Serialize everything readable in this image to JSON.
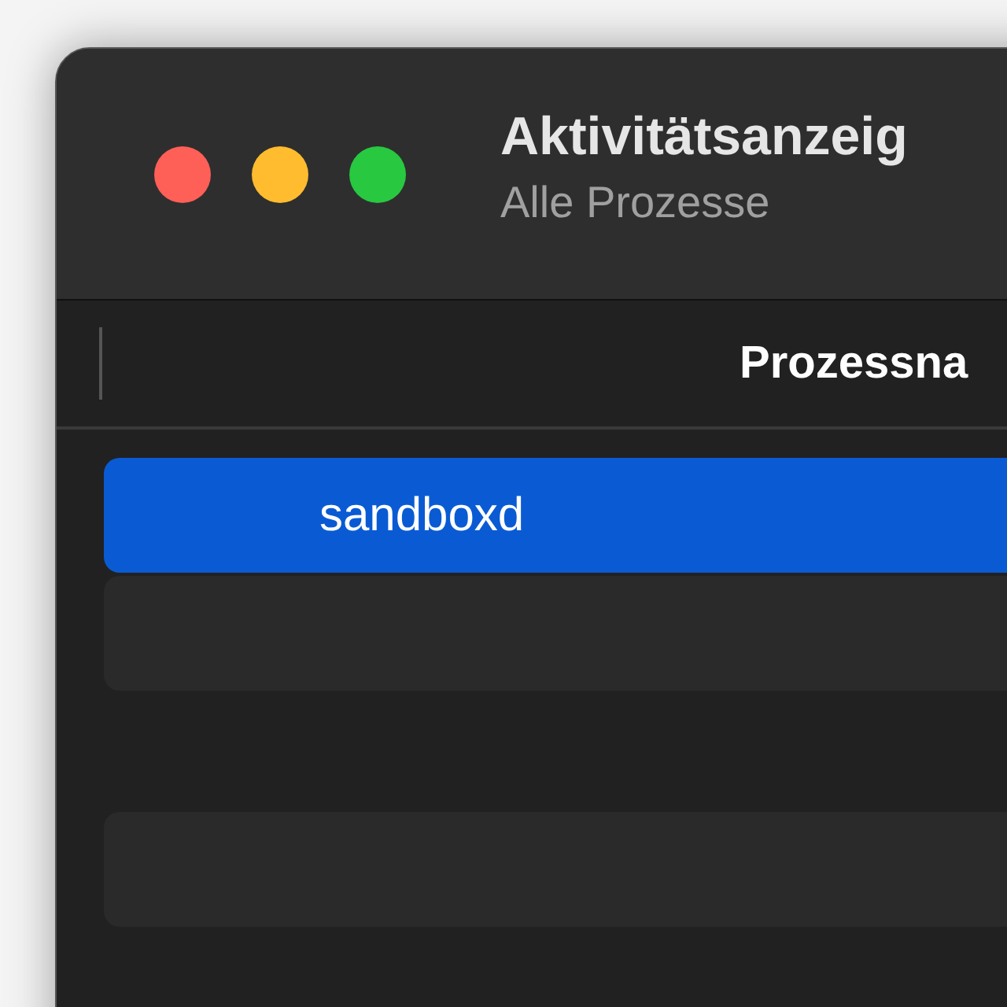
{
  "window": {
    "title": "Aktivitätsanzeig",
    "subtitle": "Alle Prozesse"
  },
  "table": {
    "columns": [
      {
        "label": "Prozessna"
      }
    ],
    "rows": [
      {
        "name": "sandboxd",
        "selected": true
      }
    ]
  }
}
